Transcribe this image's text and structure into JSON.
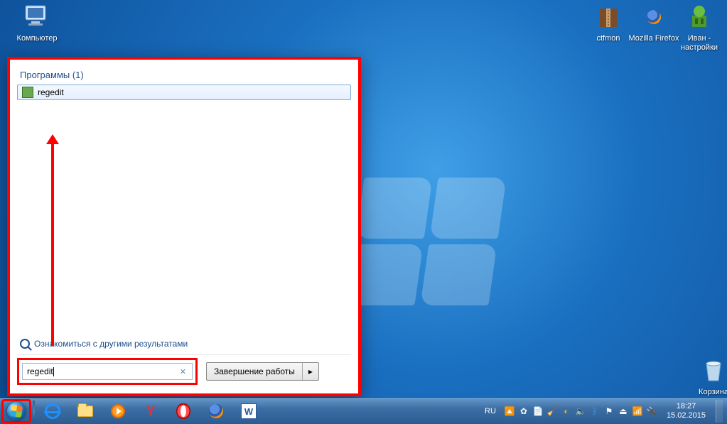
{
  "desktop": {
    "computer": "Компьютер",
    "ctfmon": "ctfmon",
    "firefox": "Mozilla Firefox",
    "ivan": "Иван - настройки",
    "trash": "Корзина"
  },
  "start_menu": {
    "programs_header": "Программы (1)",
    "result_label": "regedit",
    "more_results": "Ознакомиться с другими результатами",
    "search_value": "regedit",
    "shutdown_label": "Завершение работы",
    "shutdown_arrow": "▸"
  },
  "taskbar": {
    "lang": "RU"
  },
  "tray": {
    "time": "18:27",
    "date": "15.02.2015"
  }
}
